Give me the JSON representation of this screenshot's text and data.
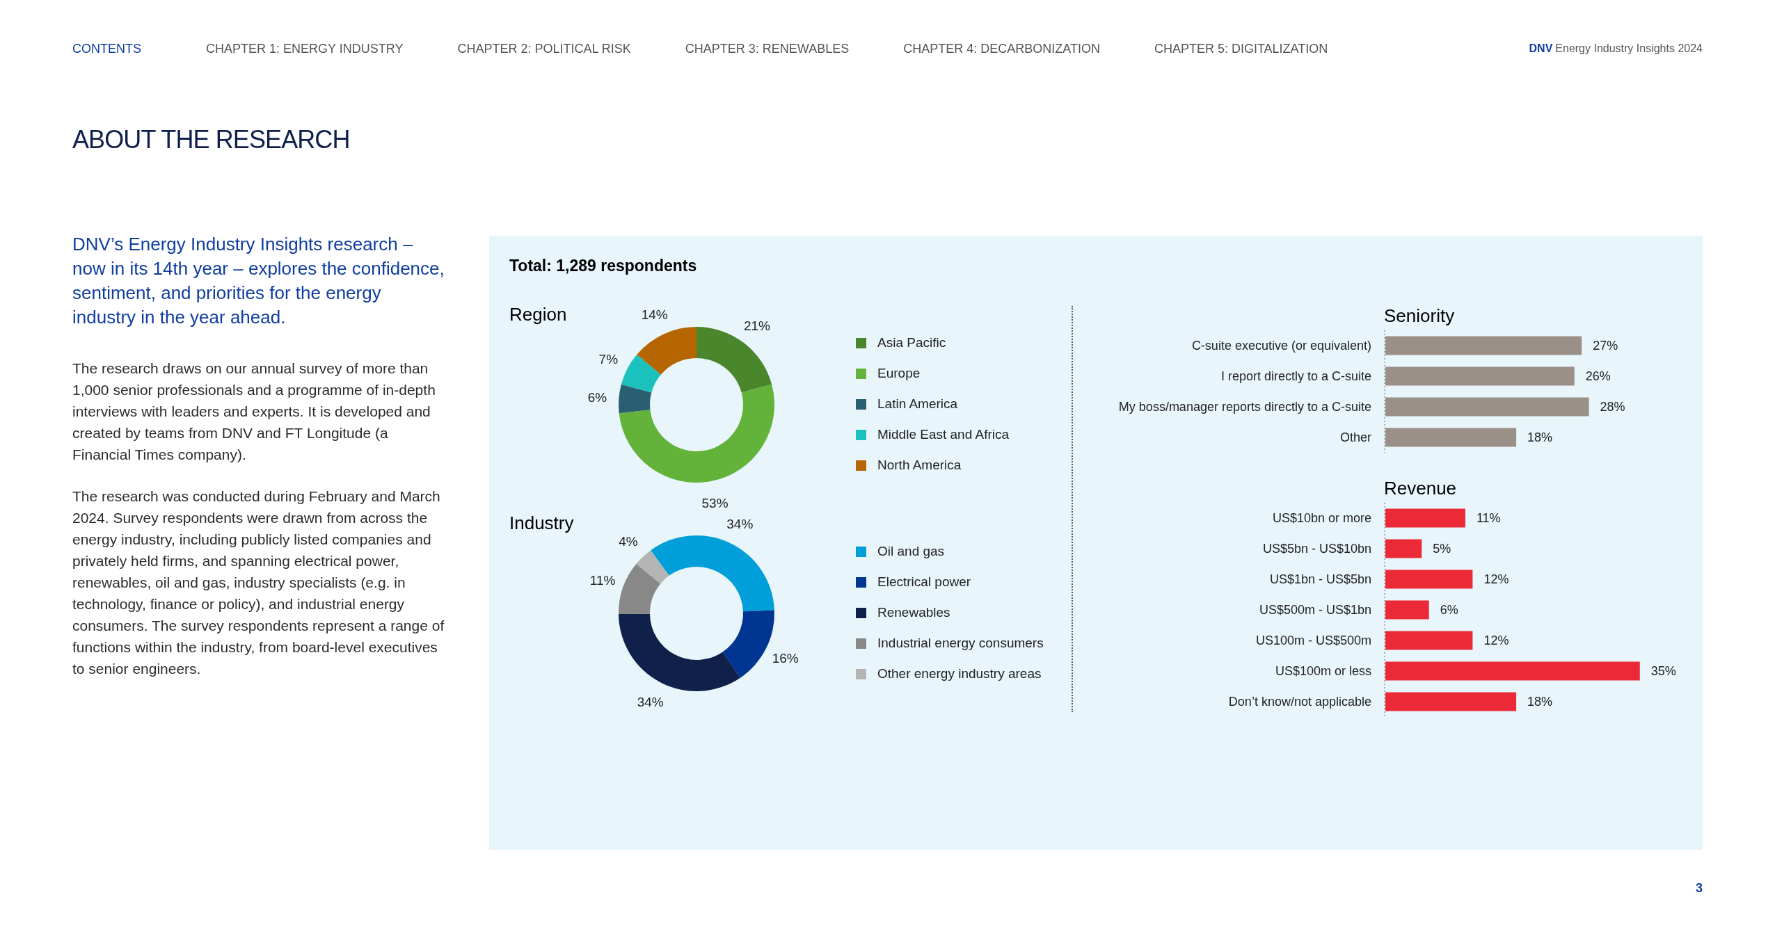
{
  "nav": {
    "items": [
      {
        "label": "CONTENTS",
        "selected": true
      },
      {
        "label": "CHAPTER 1: ENERGY INDUSTRY",
        "selected": false
      },
      {
        "label": "CHAPTER 2: POLITICAL RISK",
        "selected": false
      },
      {
        "label": "CHAPTER 3: RENEWABLES",
        "selected": false
      },
      {
        "label": "CHAPTER 4: DECARBONIZATION",
        "selected": false
      },
      {
        "label": "CHAPTER 5: DIGITALIZATION",
        "selected": false
      }
    ],
    "brand": "DNV",
    "publication": "Energy Industry Insights 2024"
  },
  "page_title": "ABOUT THE RESEARCH",
  "intro": "DNV’s Energy Industry Insights research – now in its 14th year – explores the confidence, sentiment, and priorities for the energy industry in the year ahead.",
  "paragraphs": [
    "The research draws on our annual survey of more than 1,000 senior professionals and a programme of in-depth interviews with leaders and experts. It is developed and created by teams from DNV and FT Longitude (a Financial Times company).",
    "The research was conducted during February and March 2024. Survey respondents were drawn from across the energy industry, including publicly listed companies and privately held firms, and spanning electrical power, renewables, oil and gas, industry specialists (e.g. in technology, finance or policy), and industrial energy consumers. The survey respondents represent a range of functions within the industry, from board-level executives to senior engineers."
  ],
  "panel": {
    "total": "Total: 1,289 respondents",
    "donuts": [
      {
        "chart_data": {
          "type": "donut",
          "title": "Region",
          "categories": [
            "Asia Pacific",
            "Europe",
            "Latin America",
            "Middle East and Africa",
            "North America"
          ],
          "values": [
            21,
            53,
            6,
            7,
            14
          ],
          "colors": [
            "#4a862c",
            "#63b23a",
            "#2a5f72",
            "#1bc1bd",
            "#b56600"
          ],
          "value_labels": [
            "21%",
            "53%",
            "6%",
            "7%",
            "14%"
          ]
        }
      },
      {
        "chart_data": {
          "type": "donut",
          "title": "Industry",
          "categories": [
            "Oil and gas",
            "Electrical power",
            "Renewables",
            "Industrial energy consumers",
            "Other energy industry areas"
          ],
          "values": [
            34,
            16,
            34,
            11,
            4
          ],
          "colors": [
            "#009fda",
            "#003591",
            "#0f204b",
            "#888888",
            "#b4b4b4"
          ],
          "value_labels": [
            "34%",
            "16%",
            "34%",
            "11%",
            "4%"
          ]
        }
      }
    ],
    "bars": [
      {
        "chart_data": {
          "type": "bar",
          "orientation": "horizontal",
          "title": "Seniority",
          "categories": [
            "C-suite executive (or equivalent)",
            "I report directly to a C-suite",
            "My boss/manager reports directly to a C-suite",
            "Other"
          ],
          "values": [
            27,
            26,
            28,
            18
          ],
          "colors": [
            "#9a9087",
            "#9a9087",
            "#9a9087",
            "#9a9087"
          ],
          "value_labels": [
            "27%",
            "26%",
            "28%",
            "18%"
          ]
        }
      },
      {
        "chart_data": {
          "type": "bar",
          "orientation": "horizontal",
          "title": "Revenue",
          "categories": [
            "US$10bn or more",
            "US$5bn - US$10bn",
            "US$1bn - US$5bn",
            "US$500m - US$1bn",
            "US100m - US$500m",
            "US$100m or less",
            "Don’t know/not applicable"
          ],
          "values": [
            11,
            5,
            12,
            6,
            12,
            35,
            18
          ],
          "colors": [
            "#ec2a37",
            "#ec2a37",
            "#ec2a37",
            "#ec2a37",
            "#ec2a37",
            "#ec2a37",
            "#ec2a37"
          ],
          "value_labels": [
            "11%",
            "5%",
            "12%",
            "6%",
            "12%",
            "35%",
            "18%"
          ]
        }
      }
    ]
  },
  "page_number": "3"
}
